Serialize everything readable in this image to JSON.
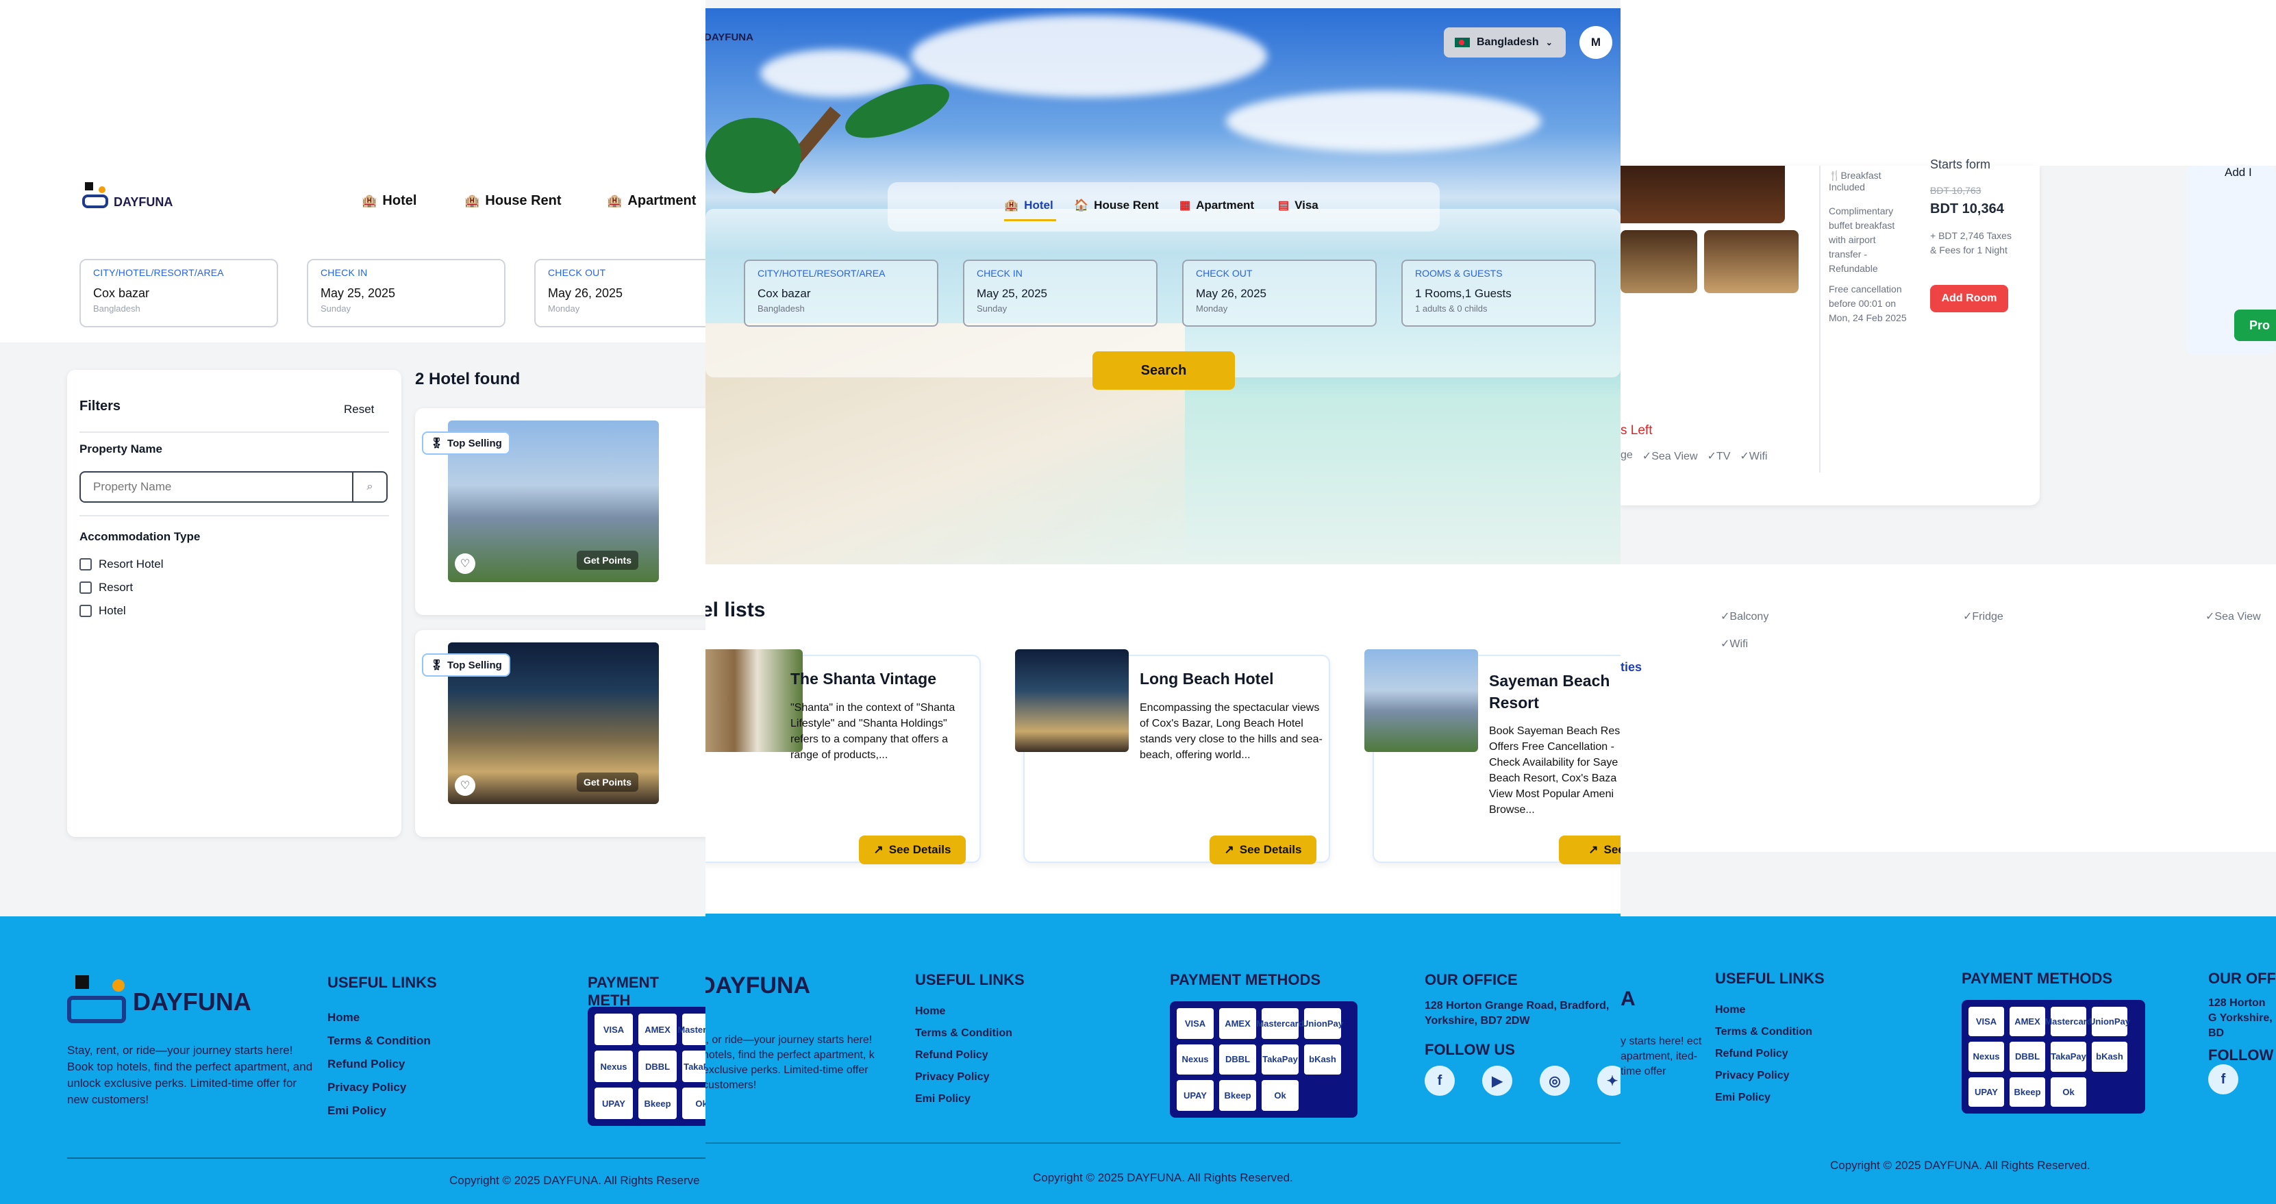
{
  "brand": "DAYFUNA",
  "colors": {
    "accent_yellow": "#eab308",
    "footer_blue": "#0ea5e9",
    "navy": "#0c1280",
    "link_blue": "#2563eb",
    "red": "#ef4444"
  },
  "left": {
    "nav": [
      {
        "label": "Hotel",
        "icon": "hotel-icon"
      },
      {
        "label": "House Rent",
        "icon": "house-icon"
      },
      {
        "label": "Apartment",
        "icon": "apartment-icon"
      }
    ],
    "search": [
      {
        "label": "CITY/HOTEL/RESORT/AREA",
        "value": "Cox bazar",
        "sub": "Bangladesh"
      },
      {
        "label": "CHECK IN",
        "value": "May 25, 2025",
        "sub": "Sunday"
      },
      {
        "label": "CHECK OUT",
        "value": "May 26, 2025",
        "sub": "Monday"
      }
    ],
    "filters": {
      "title": "Filters",
      "reset": "Reset",
      "property_name_label": "Property Name",
      "property_name_placeholder": "Property Name",
      "accommodation_label": "Accommodation Type",
      "options": [
        "Resort Hotel",
        "Resort",
        "Hotel"
      ]
    },
    "results_title": "2 Hotel found",
    "badge": "Top Selling",
    "points": "Get Points"
  },
  "mid": {
    "country": "Bangladesh",
    "avatar": "M",
    "tabs": [
      {
        "label": "Hotel",
        "icon": "hotel-icon"
      },
      {
        "label": "House Rent",
        "icon": "house-icon"
      },
      {
        "label": "Apartment",
        "icon": "apartment-icon"
      },
      {
        "label": "Visa",
        "icon": "visa-icon"
      }
    ],
    "search": [
      {
        "label": "CITY/HOTEL/RESORT/AREA",
        "value": "Cox bazar",
        "sub": "Bangladesh"
      },
      {
        "label": "CHECK IN",
        "value": "May 25, 2025",
        "sub": "Sunday"
      },
      {
        "label": "CHECK OUT",
        "value": "May 26, 2025",
        "sub": "Monday"
      },
      {
        "label": "ROOMS & GUESTS",
        "value": "1 Rooms,1 Guests",
        "sub": "1 adults & 0 childs"
      }
    ],
    "search_button": "Search",
    "list_title": "el lists",
    "hotels": [
      {
        "name": "The Shanta Vintage",
        "desc": "\"Shanta\" in the context of \"Shanta Lifestyle\" and \"Shanta Holdings\" refers to a company that offers a range of products,...",
        "button": "See Details"
      },
      {
        "name": "Long Beach Hotel",
        "desc": "Encompassing the spectacular views of Cox's Bazar, Long Beach Hotel stands very close to the hills and sea-beach, offering world...",
        "button": "See Details"
      },
      {
        "name": "Sayeman Beach Resort",
        "desc": "Book Sayeman Beach Res Offers Free Cancellation - Check Availability for Saye Beach Resort, Cox's Baza View Most Popular Ameni Browse...",
        "button": "See D"
      }
    ]
  },
  "footer": {
    "tagline": "Stay, rent, or ride—your journey starts here! Book top hotels, find the perfect apartment, and unlock exclusive perks. Limited-time offer for new customers!",
    "useful_links_title": "USEFUL LINKS",
    "links": [
      "Home",
      "Terms & Condition",
      "Refund Policy",
      "Privacy Policy",
      "Emi Policy"
    ],
    "payment_title": "PAYMENT METHODS",
    "payment_title_cut": "PAYMENT METH",
    "payments": [
      "VISA",
      "AMEX",
      "Mastercard",
      "UnionPay",
      "Nexus",
      "DBBL",
      "TakaPay",
      "bKash",
      "UPAY",
      "Bkeep",
      "Ok"
    ],
    "office_title": "OUR OFFICE",
    "office_title_cut": "OUR OFFI",
    "address": "128 Horton Grange Road, Bradford, Yorkshire, BD7 2DW",
    "address_cut": "128 Horton G Yorkshire, BD",
    "follow": "FOLLOW US",
    "follow_cut": "FOLLOW U",
    "copyright": "Copyright © 2025 DAYFUNA. All Rights Reserved.",
    "copyright_cut": "Copyright © 2025 DAYFUNA. All Rights Reserve",
    "mid_tagline": "t, or ride—your journey starts here! hotels, find the perfect apartment, k exclusive perks. Limited-time offer customers!",
    "right_tagline": "y starts here! ect apartment, ited-time offer"
  },
  "right": {
    "breakfast": "Breakfast Included",
    "meal_text": "Complimentary buffet breakfast with airport transfer - Refundable",
    "cancel_text": "Free cancellation before 00:01 on Mon, 24 Feb 2025",
    "starts_from": "Starts form",
    "old_price": "BDT 10,763",
    "price": "BDT 10,364",
    "taxes": "+ BDT 2,746 Taxes & Fees for 1 Night",
    "add_room": "Add Room",
    "rooms_left": "s Left",
    "amenities_inline": [
      "ge",
      "Sea View",
      "TV",
      "Wifi"
    ],
    "add_label": "Add I",
    "pro_button": "Pro",
    "amenities_grid": [
      "Balcony",
      "Fridge",
      "Sea View",
      "Wifi"
    ],
    "ties_link": "ties"
  }
}
